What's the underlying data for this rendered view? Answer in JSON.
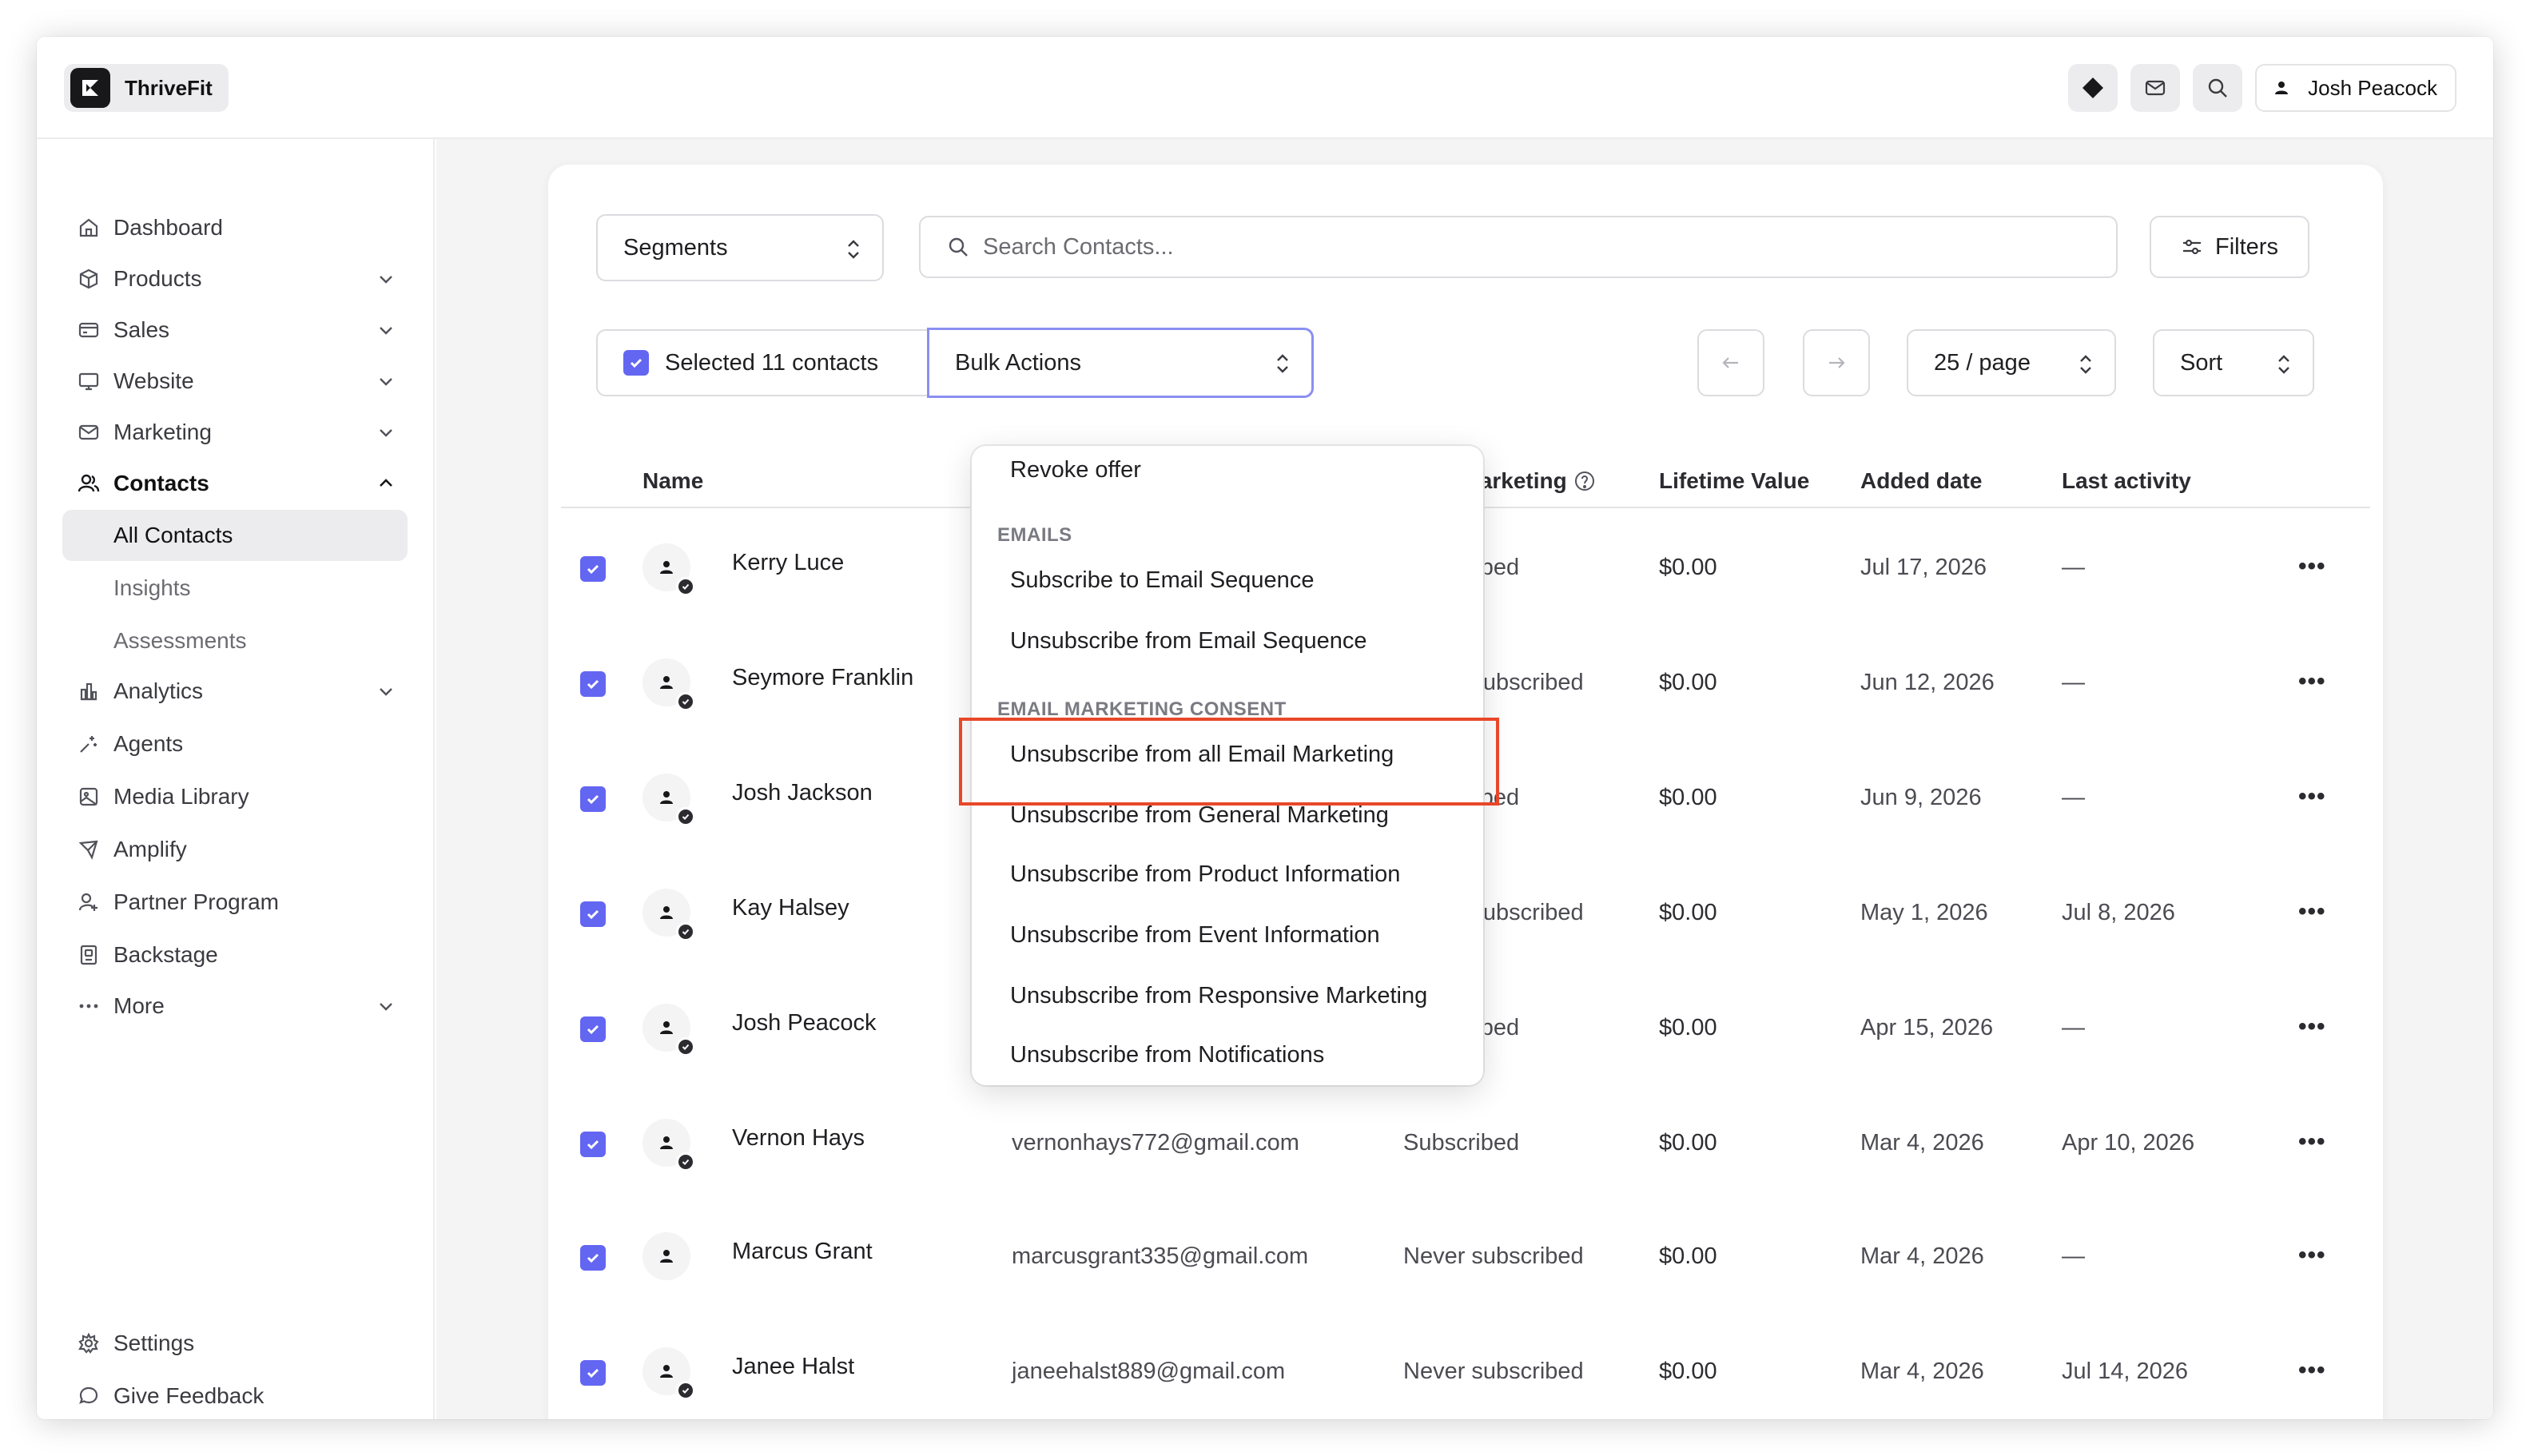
{
  "app": {
    "name": "ThriveFit"
  },
  "topbar": {
    "icons": [
      "diamond-icon",
      "mail-icon",
      "search-icon"
    ],
    "user_name": "Josh Peacock"
  },
  "sidebar": {
    "items": [
      {
        "label": "Dashboard",
        "icon": "home-icon"
      },
      {
        "label": "Products",
        "icon": "box-icon"
      },
      {
        "label": "Sales",
        "icon": "card-icon"
      },
      {
        "label": "Website",
        "icon": "monitor-icon"
      },
      {
        "label": "Marketing",
        "icon": "mail-icon"
      },
      {
        "label": "Contacts",
        "icon": "users-icon"
      },
      {
        "label": "All Contacts"
      },
      {
        "label": "Insights"
      },
      {
        "label": "Assessments"
      },
      {
        "label": "Analytics",
        "icon": "chart-icon"
      },
      {
        "label": "Agents",
        "icon": "sparkle-icon"
      },
      {
        "label": "Media Library",
        "icon": "image-icon"
      },
      {
        "label": "Amplify",
        "icon": "send-icon"
      },
      {
        "label": "Partner Program",
        "icon": "partner-icon"
      },
      {
        "label": "Backstage",
        "icon": "backstage-icon"
      },
      {
        "label": "More",
        "icon": "dots-icon"
      }
    ],
    "footer": [
      {
        "label": "Settings",
        "icon": "gear-icon"
      },
      {
        "label": "Give Feedback",
        "icon": "chat-icon"
      }
    ]
  },
  "toolbar": {
    "segments_label": "Segments",
    "search_placeholder": "Search Contacts...",
    "filters_label": "Filters",
    "selected_label": "Selected 11 contacts",
    "bulk_actions_label": "Bulk Actions",
    "page_size_label": "25 / page",
    "sort_label": "Sort"
  },
  "table": {
    "columns": [
      "Name",
      "Email Marketing",
      "Lifetime Value",
      "Added date",
      "Last activity"
    ],
    "rows": [
      {
        "name": "Kerry Luce",
        "email": "",
        "status": "Subscribed",
        "lifetime_value": "$0.00",
        "added": "Jul 17, 2026",
        "last_activity": "—"
      },
      {
        "name": "Seymore Franklin",
        "email": "",
        "status": "Never subscribed",
        "lifetime_value": "$0.00",
        "added": "Jun 12, 2026",
        "last_activity": "—"
      },
      {
        "name": "Josh Jackson",
        "email": "",
        "status": "Subscribed",
        "lifetime_value": "$0.00",
        "added": "Jun 9, 2026",
        "last_activity": "—"
      },
      {
        "name": "Kay Halsey",
        "email": "",
        "status": "Never subscribed",
        "lifetime_value": "$0.00",
        "added": "May 1, 2026",
        "last_activity": "Jul 8, 2026"
      },
      {
        "name": "Josh Peacock",
        "email": "",
        "status": "Subscribed",
        "lifetime_value": "$0.00",
        "added": "Apr 15, 2026",
        "last_activity": "—"
      },
      {
        "name": "Vernon Hays",
        "email": "vernonhays772@gmail.com",
        "status": "Subscribed",
        "lifetime_value": "$0.00",
        "added": "Mar 4, 2026",
        "last_activity": "Apr 10, 2026"
      },
      {
        "name": "Marcus Grant",
        "email": "marcusgrant335@gmail.com",
        "status": "Never subscribed",
        "lifetime_value": "$0.00",
        "added": "Mar 4, 2026",
        "last_activity": "—"
      },
      {
        "name": "Janee Halst",
        "email": "janeehalst889@gmail.com",
        "status": "Never subscribed",
        "lifetime_value": "$0.00",
        "added": "Mar 4, 2026",
        "last_activity": "Jul 14, 2026"
      }
    ]
  },
  "bulk_menu": {
    "items": [
      {
        "type": "item",
        "label": "Revoke offer"
      },
      {
        "type": "group",
        "label": "EMAILS"
      },
      {
        "type": "item",
        "label": "Subscribe to Email Sequence"
      },
      {
        "type": "item",
        "label": "Unsubscribe from Email Sequence"
      },
      {
        "type": "group",
        "label": "EMAIL MARKETING CONSENT"
      },
      {
        "type": "item",
        "label": "Unsubscribe from all Email Marketing"
      },
      {
        "type": "item",
        "label": "Unsubscribe from General Marketing"
      },
      {
        "type": "item",
        "label": "Unsubscribe from Product Information"
      },
      {
        "type": "item",
        "label": "Unsubscribe from Event Information"
      },
      {
        "type": "item",
        "label": "Unsubscribe from Responsive Marketing"
      },
      {
        "type": "item",
        "label": "Unsubscribe from Notifications"
      }
    ]
  },
  "colors": {
    "accent": "#6366f1",
    "highlight": "#e8472a"
  }
}
